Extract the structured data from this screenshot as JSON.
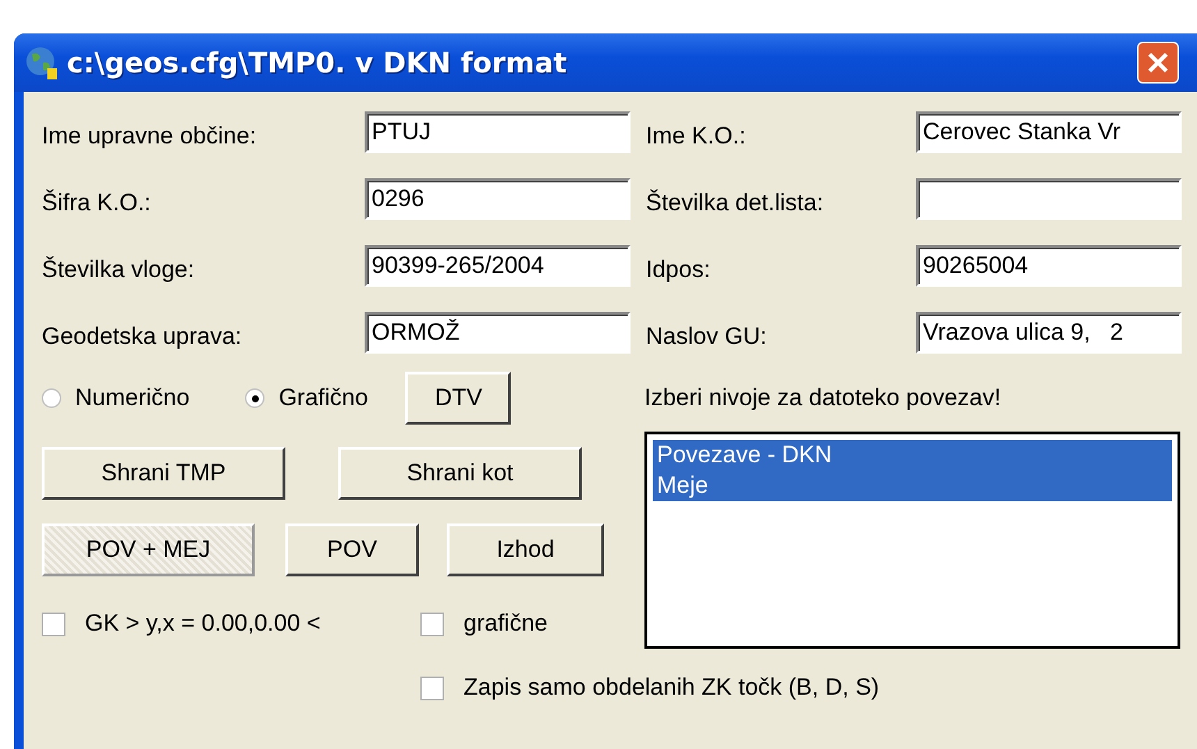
{
  "window": {
    "title": "c:\\geos.cfg\\TMP0. v DKN format"
  },
  "fields_left": [
    {
      "label": "Ime upravne občine:",
      "value": "PTUJ"
    },
    {
      "label": "Šifra K.O.:",
      "value": "0296"
    },
    {
      "label": "Številka vloge:",
      "value": "90399-265/2004"
    },
    {
      "label": "Geodetska uprava:",
      "value": "ORMOŽ"
    }
  ],
  "fields_right": [
    {
      "label": "Ime K.O.:",
      "value": "Cerovec Stanka Vr"
    },
    {
      "label": "Številka det.lista:"
    },
    {
      "label": "Idpos:",
      "value": "90265004"
    },
    {
      "label": "Naslov GU:",
      "value": "Vrazova ulica 9,   2"
    }
  ],
  "mode_radios": [
    {
      "label": "Numerično",
      "selected": false
    },
    {
      "label": "Grafično",
      "selected": true
    }
  ],
  "dtv_button": "DTV",
  "save_buttons": [
    {
      "label": "Shrani TMP",
      "pressed": false
    },
    {
      "label": "Shrani kot",
      "pressed": false
    }
  ],
  "action_buttons": [
    {
      "label": "POV + MEJ",
      "pressed": true
    },
    {
      "label": "POV",
      "pressed": false
    },
    {
      "label": "Izhod",
      "pressed": false
    }
  ],
  "checkboxes": [
    {
      "label": "GK > y,x = 0.00,0.00 <",
      "checked": false
    },
    {
      "label": "grafične",
      "checked": false
    }
  ],
  "levels_hint": "Izberi nivoje za datoteko povezav!",
  "levels_list": [
    {
      "label": "Povezave - DKN",
      "selected": true
    },
    {
      "label": "Meje",
      "selected": true
    }
  ],
  "bottom_checkbox": {
    "label": "Zapis samo obdelanih ZK točk (B, D, S)",
    "checked": false
  }
}
